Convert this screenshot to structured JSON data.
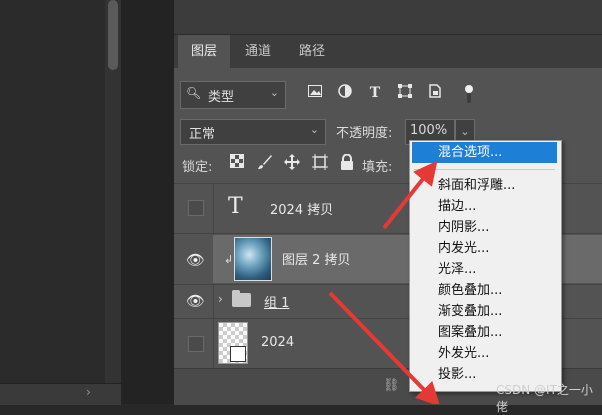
{
  "panel": {
    "tabs": [
      {
        "label": "图层"
      },
      {
        "label": "通道"
      },
      {
        "label": "路径"
      }
    ]
  },
  "filter": {
    "kind_label": "类型",
    "icons": [
      "image-filter-icon",
      "adjustment-filter-icon",
      "type-filter-icon",
      "shape-filter-icon",
      "smart-object-filter-icon",
      "filter-toggle-icon"
    ]
  },
  "blend": {
    "mode": "正常",
    "opacity_label": "不透明度:",
    "opacity_value": "100%"
  },
  "lock": {
    "label": "锁定:",
    "fill_label": "填充:"
  },
  "layers": [
    {
      "name": "2024 拷贝",
      "type": "text",
      "visible": false
    },
    {
      "name": "图层 2 拷贝",
      "type": "image",
      "visible": true,
      "selected": true
    },
    {
      "name": "组 1",
      "type": "group",
      "visible": true
    },
    {
      "name": "2024",
      "type": "smart-object",
      "visible": false
    }
  ],
  "context_menu": {
    "items": [
      {
        "label": "混合选项...",
        "highlighted": true
      },
      {
        "label": "斜面和浮雕..."
      },
      {
        "label": "描边..."
      },
      {
        "label": "内阴影..."
      },
      {
        "label": "内发光..."
      },
      {
        "label": "光泽..."
      },
      {
        "label": "颜色叠加..."
      },
      {
        "label": "渐变叠加..."
      },
      {
        "label": "图案叠加..."
      },
      {
        "label": "外发光..."
      },
      {
        "label": "投影..."
      }
    ]
  },
  "watermark": "CSDN @IT之一小佬",
  "colors": {
    "menu_highlight": "#1e7fd6",
    "arrow": "#e53935",
    "panel_bg": "#535353"
  }
}
